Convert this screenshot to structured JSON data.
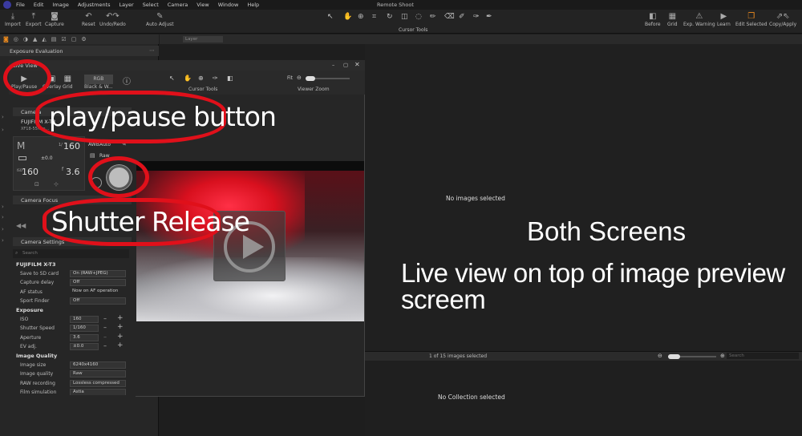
{
  "app": {
    "title": "Remote Shoot"
  },
  "menu": [
    "File",
    "Edit",
    "Image",
    "Adjustments",
    "Layer",
    "Select",
    "Camera",
    "View",
    "Window",
    "Help"
  ],
  "toolbar": {
    "left": [
      {
        "label": "Import",
        "icon": "import-icon"
      },
      {
        "label": "Export",
        "icon": "export-icon"
      },
      {
        "label": "Capture",
        "icon": "camera-icon"
      },
      {
        "label": "Reset",
        "icon": "reset-icon"
      },
      {
        "label": "Undo/Redo",
        "icon": "undo-icon"
      },
      {
        "label": "Auto Adjust",
        "icon": "wand-icon"
      }
    ],
    "cursor_tools_label": "Cursor Tools",
    "right": [
      {
        "label": "Before",
        "icon": "before-icon"
      },
      {
        "label": "Grid",
        "icon": "grid-icon"
      },
      {
        "label": "Exp. Warning",
        "icon": "warning-icon"
      },
      {
        "label": "Learn",
        "icon": "learn-icon"
      },
      {
        "label": "Edit Selected",
        "icon": "edit-selected-icon"
      },
      {
        "label": "Copy/Apply",
        "icon": "copy-apply-icon"
      }
    ]
  },
  "left_panel": {
    "header": "Exposure Evaluation",
    "layer_placeholder": "Layer"
  },
  "live_view": {
    "title": "Live View",
    "tools": [
      "Play/Pause",
      "Overlay",
      "Grid",
      "Black & W...",
      "Cursor Tools",
      "Fit",
      "Viewer Zoom"
    ],
    "rgb_label": "RGB",
    "camera_header": "Camera",
    "camera_name": "FUJIFILM X-T3",
    "lens": "XF18-55mm...",
    "mode": "M",
    "shutter": "160",
    "shutter_prefix": "1/",
    "ev": "±0.0",
    "iso": "160",
    "iso_prefix": "ISO",
    "aperture": "3.6",
    "aperture_prefix": "f",
    "wb": "Auto",
    "wb_prefix": "AWB",
    "format": "Raw",
    "camera_focus_header": "Camera Focus",
    "camera_settings_header": "Camera Settings",
    "search_placeholder": "Search",
    "settings_title": "FUJIFILM X-T3",
    "rows1": [
      {
        "label": "Save to SD card",
        "value": "On (RAW+JPEG)"
      },
      {
        "label": "Capture delay",
        "value": "Off"
      },
      {
        "label": "AF status",
        "value": "Now on AF operation"
      },
      {
        "label": "Sport Finder",
        "value": "Off"
      }
    ],
    "exposure_title": "Exposure",
    "rows2": [
      {
        "label": "ISO",
        "value": "160"
      },
      {
        "label": "Shutter Speed",
        "value": "1/160"
      },
      {
        "label": "Aperture",
        "value": "3.6"
      },
      {
        "label": "EV adj.",
        "value": "±0.0"
      }
    ],
    "quality_title": "Image Quality",
    "rows3": [
      {
        "label": "Image size",
        "value": "6240x4160"
      },
      {
        "label": "Image quality",
        "value": "Raw"
      },
      {
        "label": "RAW recording",
        "value": "Lossless compressed"
      },
      {
        "label": "Film simulation",
        "value": "Astia"
      }
    ]
  },
  "viewer": {
    "no_images": "No images selected",
    "count": "1 of 15 images selected",
    "search_placeholder": "Search",
    "no_collection": "No Collection selected"
  },
  "annotations": {
    "play": "play/pause button",
    "shutter": "Shutter Release",
    "both": "Both Screens",
    "desc": "Live view on top of image preview screem"
  },
  "colors": {
    "annotation": "#e0101a",
    "accent": "#f08c1e"
  }
}
